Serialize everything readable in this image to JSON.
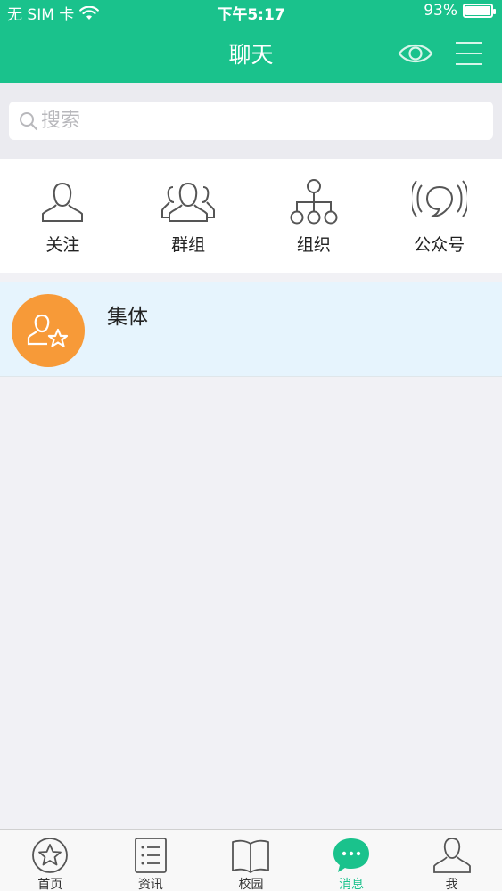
{
  "status": {
    "carrier": "无 SIM 卡",
    "time": "下午5:17",
    "battery": "93%",
    "battery_level": 0.93
  },
  "nav": {
    "title": "聊天",
    "eye_icon": "eye-icon",
    "menu_icon": "menu-icon"
  },
  "search": {
    "placeholder": "搜索",
    "value": ""
  },
  "shortcuts": [
    {
      "label": "关注",
      "icon": "person-icon"
    },
    {
      "label": "群组",
      "icon": "group-icon"
    },
    {
      "label": "组织",
      "icon": "org-chart-icon"
    },
    {
      "label": "公众号",
      "icon": "broadcast-icon"
    }
  ],
  "chats": [
    {
      "name": "集体",
      "icon": "collective-avatar-icon"
    }
  ],
  "tabs": [
    {
      "label": "首页",
      "icon": "star-icon",
      "active": false
    },
    {
      "label": "资讯",
      "icon": "news-list-icon",
      "active": false
    },
    {
      "label": "校园",
      "icon": "book-icon",
      "active": false
    },
    {
      "label": "消息",
      "icon": "chat-bubble-icon",
      "active": true
    },
    {
      "label": "我",
      "icon": "user-icon",
      "active": false
    }
  ],
  "colors": {
    "brand": "#1ac28c",
    "avatar_orange": "#f79a38",
    "chat_row_bg": "#e6f4fd"
  }
}
